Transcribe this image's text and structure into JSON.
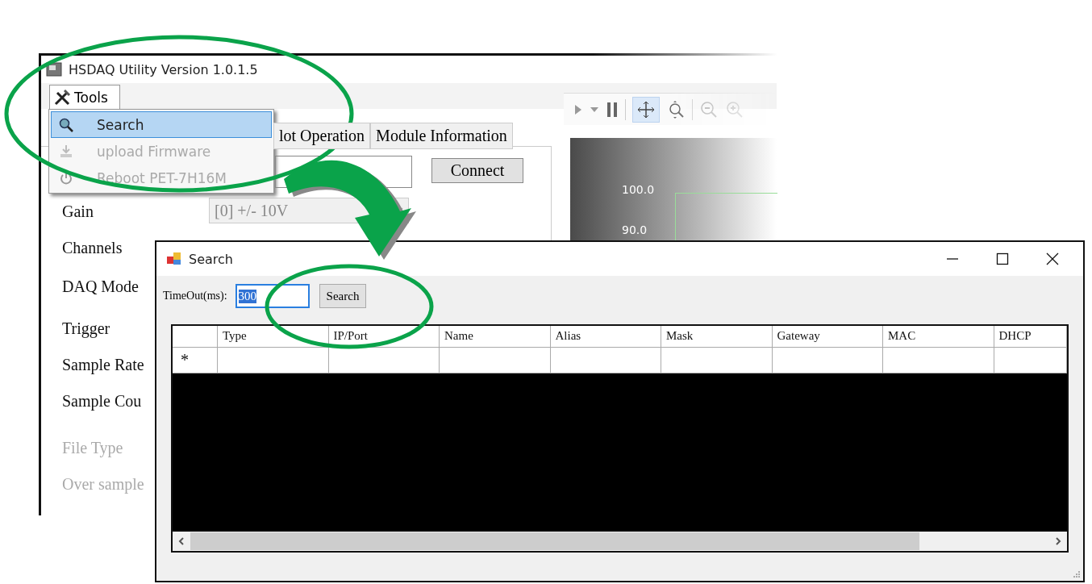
{
  "main_window": {
    "title": "HSDAQ Utility Version 1.0.1.5",
    "menu": {
      "label": "Tools",
      "items": [
        {
          "label": "Search",
          "selected": true,
          "disabled": false
        },
        {
          "label": "upload Firmware",
          "selected": false,
          "disabled": true
        },
        {
          "label": "Reboot PET-7H16M",
          "selected": false,
          "disabled": true
        }
      ]
    },
    "tabs": [
      {
        "label": "lot Operation"
      },
      {
        "label": "Module Information"
      }
    ],
    "connect_button": "Connect",
    "form": [
      {
        "label": "Gain",
        "disabled": false,
        "value": "[0] +/- 10V"
      },
      {
        "label": "Channels",
        "disabled": false
      },
      {
        "label": "DAQ Mode",
        "disabled": false
      },
      {
        "label": "Trigger",
        "disabled": false
      },
      {
        "label": "Sample Rate",
        "disabled": false
      },
      {
        "label": "Sample Cou",
        "disabled": false
      },
      {
        "label": "File Type",
        "disabled": true
      },
      {
        "label": "Over sample",
        "disabled": true
      }
    ],
    "chart": {
      "y_labels": [
        "100.0",
        "90.0"
      ]
    }
  },
  "search_dialog": {
    "title": "Search",
    "timeout_label": "TimeOut(ms):",
    "timeout_value": "300",
    "search_button": "Search",
    "columns": [
      "Type",
      "IP/Port",
      "Name",
      "Alias",
      "Mask",
      "Gateway",
      "MAC",
      "DHCP"
    ],
    "new_row_marker": "*"
  }
}
